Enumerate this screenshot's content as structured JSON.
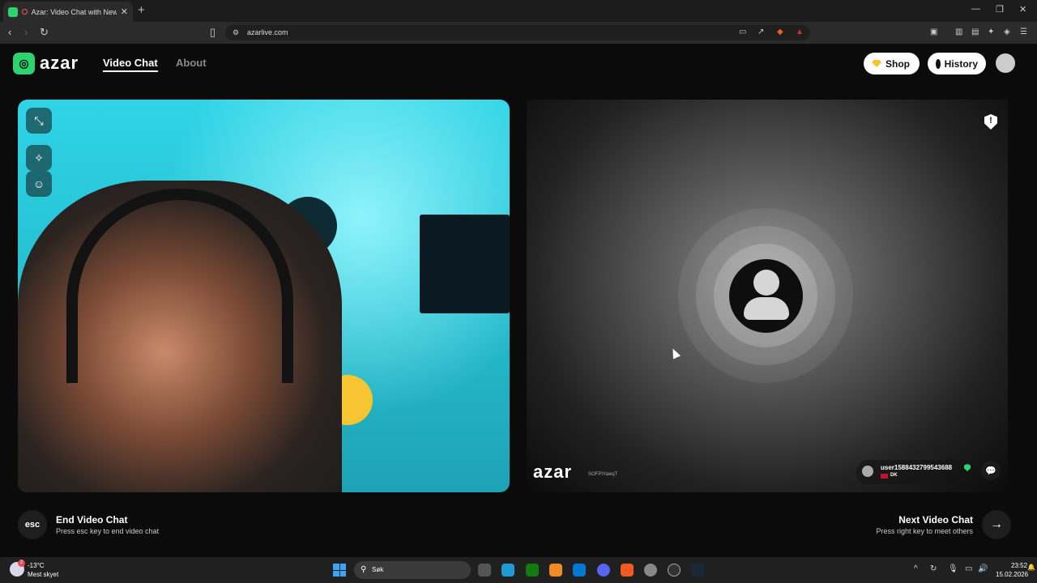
{
  "browser": {
    "tab_title": "Azar: Video Chat with New Pe",
    "tab_close": "✕",
    "new_tab": "+",
    "url": "azarlive.com",
    "win_minimize": "—",
    "win_restore": "❐",
    "win_close": "✕"
  },
  "site": {
    "logo_text": "azar",
    "nav": {
      "video_chat": "Video Chat",
      "about": "About"
    },
    "shop_label": "Shop",
    "history_label": "History"
  },
  "remote": {
    "watermark": "azar",
    "watermark_code": "SOFPIYawqT",
    "username": "user1588432799543688",
    "country": "DK"
  },
  "controls": {
    "esc_key": "esc",
    "end_title": "End Video Chat",
    "end_sub": "Press esc key to end video chat",
    "next_title": "Next Video Chat",
    "next_sub": "Press right key to meet others"
  },
  "taskbar": {
    "weather_badge": "2",
    "temperature": "-13°C",
    "weather_desc": "Mest skyet",
    "search_placeholder": "Søk",
    "time": "23:52",
    "date": "15.02.2026"
  },
  "colors": {
    "brand": "#2dd36f",
    "background": "#0b0b0b",
    "gem": "#f7c531"
  },
  "icons": [
    "fullscreen-exit-icon",
    "magic-wand-icon",
    "sticker-icon",
    "report-shield-icon",
    "chat-bubble-icon",
    "arrow-right-icon",
    "gem-icon",
    "clock-icon",
    "user-avatar-icon"
  ]
}
